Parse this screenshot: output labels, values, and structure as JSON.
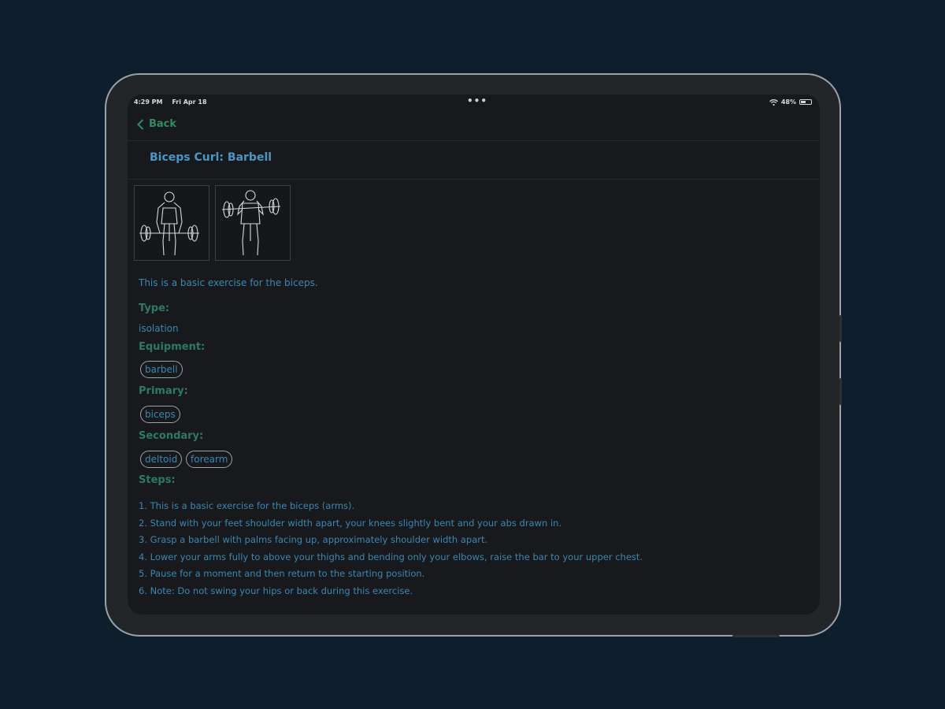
{
  "status": {
    "time": "4:29 PM",
    "date": "Fri Apr 18",
    "battery": "48%"
  },
  "nav": {
    "back_label": "Back"
  },
  "exercise": {
    "title": "Biceps Curl: Barbell",
    "images": [
      "barbell-curl-start",
      "barbell-curl-top"
    ],
    "description": "This is a basic exercise for the biceps.",
    "type_label": "Type:",
    "type_value": "isolation",
    "equipment_label": "Equipment:",
    "equipment": [
      "barbell"
    ],
    "primary_label": "Primary:",
    "primary": [
      "biceps"
    ],
    "secondary_label": "Secondary:",
    "secondary": [
      "deltoid",
      "forearm"
    ],
    "steps_label": "Steps:",
    "steps": [
      "1. This is a basic exercise for the biceps (arms).",
      "2. Stand with your feet shoulder width apart, your knees slightly bent and your abs drawn in.",
      "3. Grasp a barbell with palms facing up, approximately shoulder width apart.",
      "4. Lower your arms fully to above your thighs and bending only your elbows, raise the bar to your upper chest.",
      "5. Pause for a moment and then return to the starting position.",
      "6. Note: Do not swing your hips or back during this exercise."
    ]
  },
  "colors": {
    "background": "#0f1e2c",
    "title": "#4a96c4",
    "label": "#2e7a60",
    "text": "#3d87b1",
    "back": "#2e8b66"
  }
}
